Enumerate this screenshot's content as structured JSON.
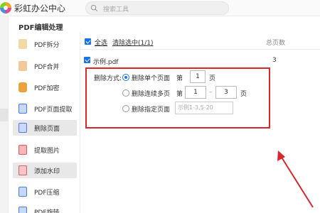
{
  "app": {
    "title": "彩虹办公中心"
  },
  "search": {
    "placeholder": "搜索工具"
  },
  "panel": {
    "title": "PDF编辑处理"
  },
  "sidebar": {
    "items": [
      {
        "label": "PDF拆分",
        "icon": "split-icon",
        "color": "#e8a33d",
        "active": false
      },
      {
        "label": "PDF合并",
        "icon": "merge-icon",
        "color": "#e88a3d",
        "active": false
      },
      {
        "label": "PDF加密",
        "icon": "lock-icon",
        "color": "#e8a33d",
        "active": false
      },
      {
        "label": "PDF页面提取",
        "icon": "page-extract-icon",
        "color": "#4a7be8",
        "active": false
      },
      {
        "label": "删除页面",
        "icon": "delete-page-icon",
        "color": "#4a7be8",
        "active": true
      },
      {
        "label": "提取图片",
        "icon": "image-icon",
        "color": "#e85a5a",
        "active": false
      },
      {
        "label": "添加水印",
        "icon": "watermark-icon",
        "color": "#e85a5a",
        "active": false
      },
      {
        "label": "PDF压缩",
        "icon": "compress-icon",
        "color": "#4a7be8",
        "active": false
      },
      {
        "label": "PDF旋转",
        "icon": "rotate-icon",
        "color": "#4a7be8",
        "active": false
      }
    ]
  },
  "header": {
    "select_all": "全选",
    "clear_selected": "清除选中(1/1)",
    "total_pages_label": "总页数"
  },
  "file": {
    "name": "示例.pdf",
    "pages": "3"
  },
  "delete_options": {
    "mode_label": "删除方式:",
    "single": {
      "label": "删除单个页面",
      "prefix": "第",
      "value": "1",
      "suffix": "页"
    },
    "range": {
      "label": "删除连续多页",
      "prefix": "第",
      "from": "1",
      "sep": "–",
      "to": "3",
      "suffix": "页"
    },
    "custom": {
      "label": "删除指定页面",
      "placeholder": "示例1-3,5-20"
    },
    "selected": "single"
  },
  "colors": {
    "accent": "#1a73e8",
    "highlight": "#d9272e"
  }
}
